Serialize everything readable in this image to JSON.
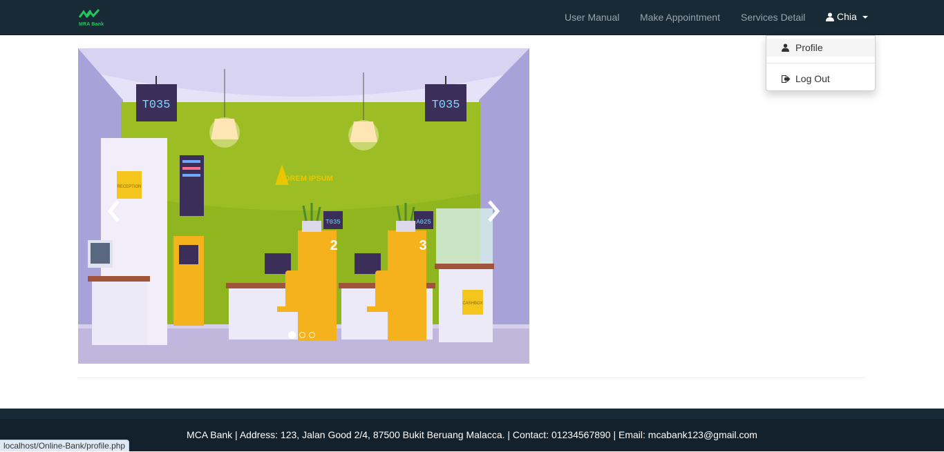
{
  "navbar": {
    "brand_text": "MRA Bank",
    "links": [
      "User Manual",
      "Make Appointment",
      "Services Detail"
    ],
    "user_name": "Chia"
  },
  "dropdown": {
    "items": [
      {
        "label": "Profile",
        "icon": "user-icon"
      },
      {
        "label": "Log Out",
        "icon": "logout-icon"
      }
    ]
  },
  "carousel": {
    "slide_count": 3,
    "active_index": 0,
    "scene_text": {
      "display_left": "T035",
      "display_right": "T035",
      "wall_logo": "LOREM IPSUM",
      "sign_reception": "RECEPTION",
      "counter_display_2": "T035",
      "counter_display_3": "A025",
      "counter_number_2": "2",
      "counter_number_3": "3",
      "sign_cashbox": "CASHBOX"
    }
  },
  "footer": {
    "text": "MCA Bank | Address: 123, Jalan Good 2/4, 87500 Bukit Beruang Malacca. | Contact: 01234567890 | Email: mcabank123@gmail.com"
  },
  "statusbar": {
    "url": "localhost/Online-Bank/profile.php"
  },
  "colors": {
    "navbar_bg": "#192a37",
    "brand_green": "#22c55e",
    "footer_bg": "#13212c"
  }
}
